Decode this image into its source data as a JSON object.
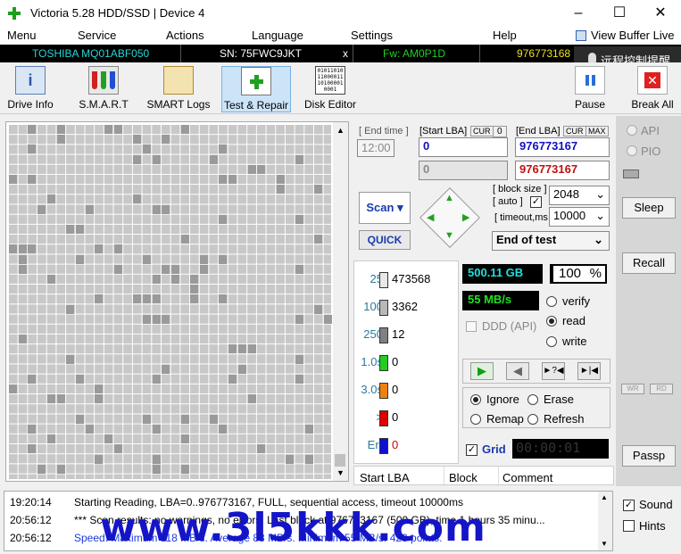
{
  "window": {
    "title": "Victoria 5.28 HDD/SSD | Device 4"
  },
  "menu": {
    "items": [
      "Menu",
      "Service",
      "Actions",
      "Language",
      "Settings",
      "Help"
    ],
    "view_buffer": "View Buffer Live"
  },
  "infobar": {
    "model": "TOSHIBA MQ01ABF050",
    "serial": "SN: 75FWC9JKT",
    "x": "x",
    "firmware": "Fw: AM0P1D",
    "lba": "976773168",
    "remote_tip": "远程控制提醒"
  },
  "toolbar": {
    "drive_info": "Drive Info",
    "smart": "S.M.A.R.T",
    "smart_logs": "SMART Logs",
    "test_repair": "Test & Repair",
    "disk_editor": "Disk Editor",
    "pause": "Pause",
    "break_all": "Break All",
    "disk_editor_icon_text": "01011010 11000011 10100001 0001"
  },
  "scan": {
    "end_time_label": "[ End time ]",
    "end_time": "12:00",
    "start_lba_label": "[Start LBA]",
    "cur": "CUR",
    "zero": "0",
    "start_lba": "0",
    "start_lba2": "0",
    "end_lba_label": "[End LBA]",
    "max": "MAX",
    "end_lba": "976773167",
    "end_lba2": "976773167",
    "block_size_label": "[ block size ]",
    "auto_label": "[ auto ]",
    "block_size": "2048",
    "timeout_label": "[ timeout,ms ]",
    "timeout": "10000",
    "scan_button": "Scan",
    "quick_button": "QUICK",
    "end_of_test": "End of test"
  },
  "legend": [
    {
      "name": "25",
      "count": "473568",
      "color": "#e8e8e8"
    },
    {
      "name": "100",
      "count": "3362",
      "color": "#b8b8b8"
    },
    {
      "name": "250",
      "count": "12",
      "color": "#808080"
    },
    {
      "name": "1.0s",
      "count": "0",
      "color": "#22cc22"
    },
    {
      "name": "3.0s",
      "count": "0",
      "color": "#f08010"
    },
    {
      "name": ">",
      "count": "0",
      "color": "#e00000"
    },
    {
      "name": "Err",
      "count": "0",
      "color": "#1010d0"
    }
  ],
  "stats": {
    "size": "500.11 GB",
    "percent": "100",
    "percent_sign": "%",
    "speed": "55 MB/s",
    "ddd": "DDD (API)",
    "verify": "verify",
    "read": "read",
    "write": "write"
  },
  "actions": {
    "ignore": "Ignore",
    "erase": "Erase",
    "remap": "Remap",
    "refresh": "Refresh",
    "grid": "Grid",
    "timer": "00:00:01"
  },
  "table_headers": [
    "Start LBA",
    "Block",
    "Comment"
  ],
  "right_panel": {
    "api": "API",
    "pio": "PIO",
    "sleep": "Sleep",
    "recall": "Recall",
    "wr": "WR",
    "rd": "RD",
    "passp": "Passp",
    "sound": "Sound",
    "hints": "Hints"
  },
  "log": [
    {
      "time": "19:20:14",
      "text": "Starting Reading, LBA=0..976773167, FULL, sequential access, timeout 10000ms",
      "color": "#000000"
    },
    {
      "time": "20:56:12",
      "text": "*** Scan results: no warnings, no errors. Last block at 976773167 (500 GB), time 1 hours 35 minu...",
      "color": "#000000"
    },
    {
      "time": "20:56:12",
      "text": "Speed: Maximum 118 MB/s. Average 88 MB/s. Minimum 55 MB/s. 423 points.",
      "color": "#1a3ae0"
    }
  ],
  "watermark": "www.3l5kkk.com"
}
